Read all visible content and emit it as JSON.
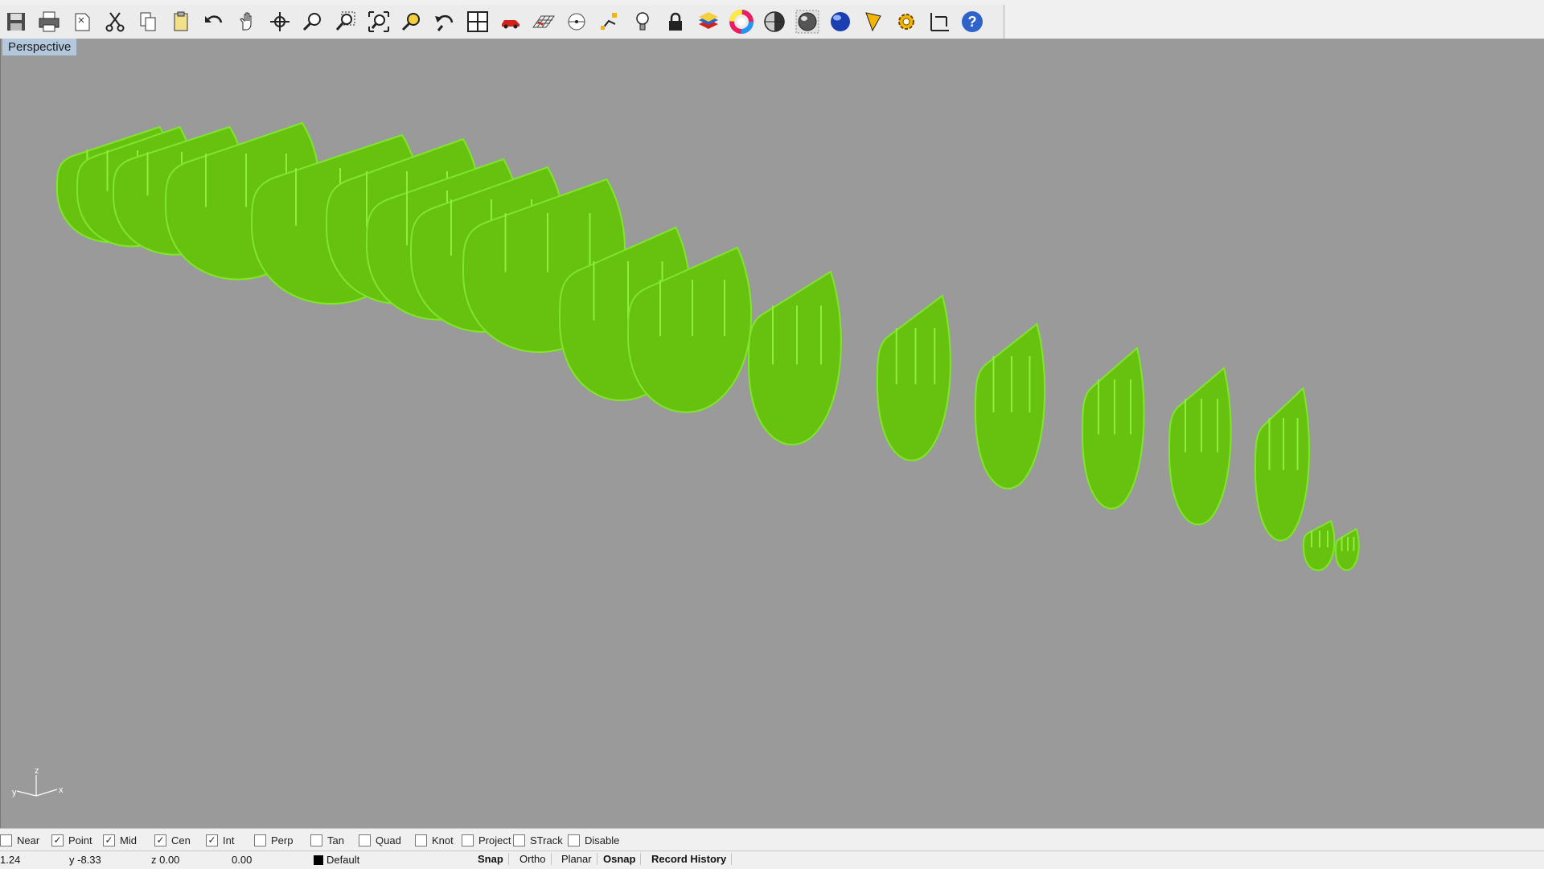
{
  "toolbar": {
    "icons": [
      "save-icon",
      "print-icon",
      "new-file-icon",
      "cut-icon",
      "copy-icon",
      "paste-icon",
      "undo-icon",
      "pan-hand-icon",
      "rotate-view-icon",
      "zoom-icon",
      "zoom-window-icon",
      "zoom-extents-icon",
      "zoom-selected-icon",
      "undo-view-icon",
      "four-viewports-icon",
      "car-icon",
      "grid-icon",
      "point-icon",
      "transform-icon",
      "light-bulb-icon",
      "lock-icon",
      "layer-icon",
      "color-wheel-icon",
      "shaded-sphere-icon",
      "render-sphere-icon",
      "blue-sphere-icon",
      "filter-icon",
      "gear-icon",
      "dimension-icon",
      "help-icon"
    ]
  },
  "viewport": {
    "label": "Perspective",
    "background": "#9a9a9a",
    "shape_color": "#66c20f",
    "axis": {
      "x": "x",
      "y": "y",
      "z": "z"
    }
  },
  "osnap": [
    {
      "label": "Near",
      "checked": false
    },
    {
      "label": "Point",
      "checked": true
    },
    {
      "label": "Mid",
      "checked": true
    },
    {
      "label": "Cen",
      "checked": true
    },
    {
      "label": "Int",
      "checked": true
    },
    {
      "label": "Perp",
      "checked": false
    },
    {
      "label": "Tan",
      "checked": false
    },
    {
      "label": "Quad",
      "checked": false
    },
    {
      "label": "Knot",
      "checked": false
    },
    {
      "label": "Project",
      "checked": false
    },
    {
      "label": "STrack",
      "checked": false
    },
    {
      "label": "Disable",
      "checked": false
    }
  ],
  "status": {
    "x": "1.24",
    "y": "y -8.33",
    "z": "z 0.00",
    "dist": "0.00",
    "layer": "Default",
    "snap": "Snap",
    "ortho": "Ortho",
    "planar": "Planar",
    "osnap": "Osnap",
    "record_history": "Record History"
  }
}
